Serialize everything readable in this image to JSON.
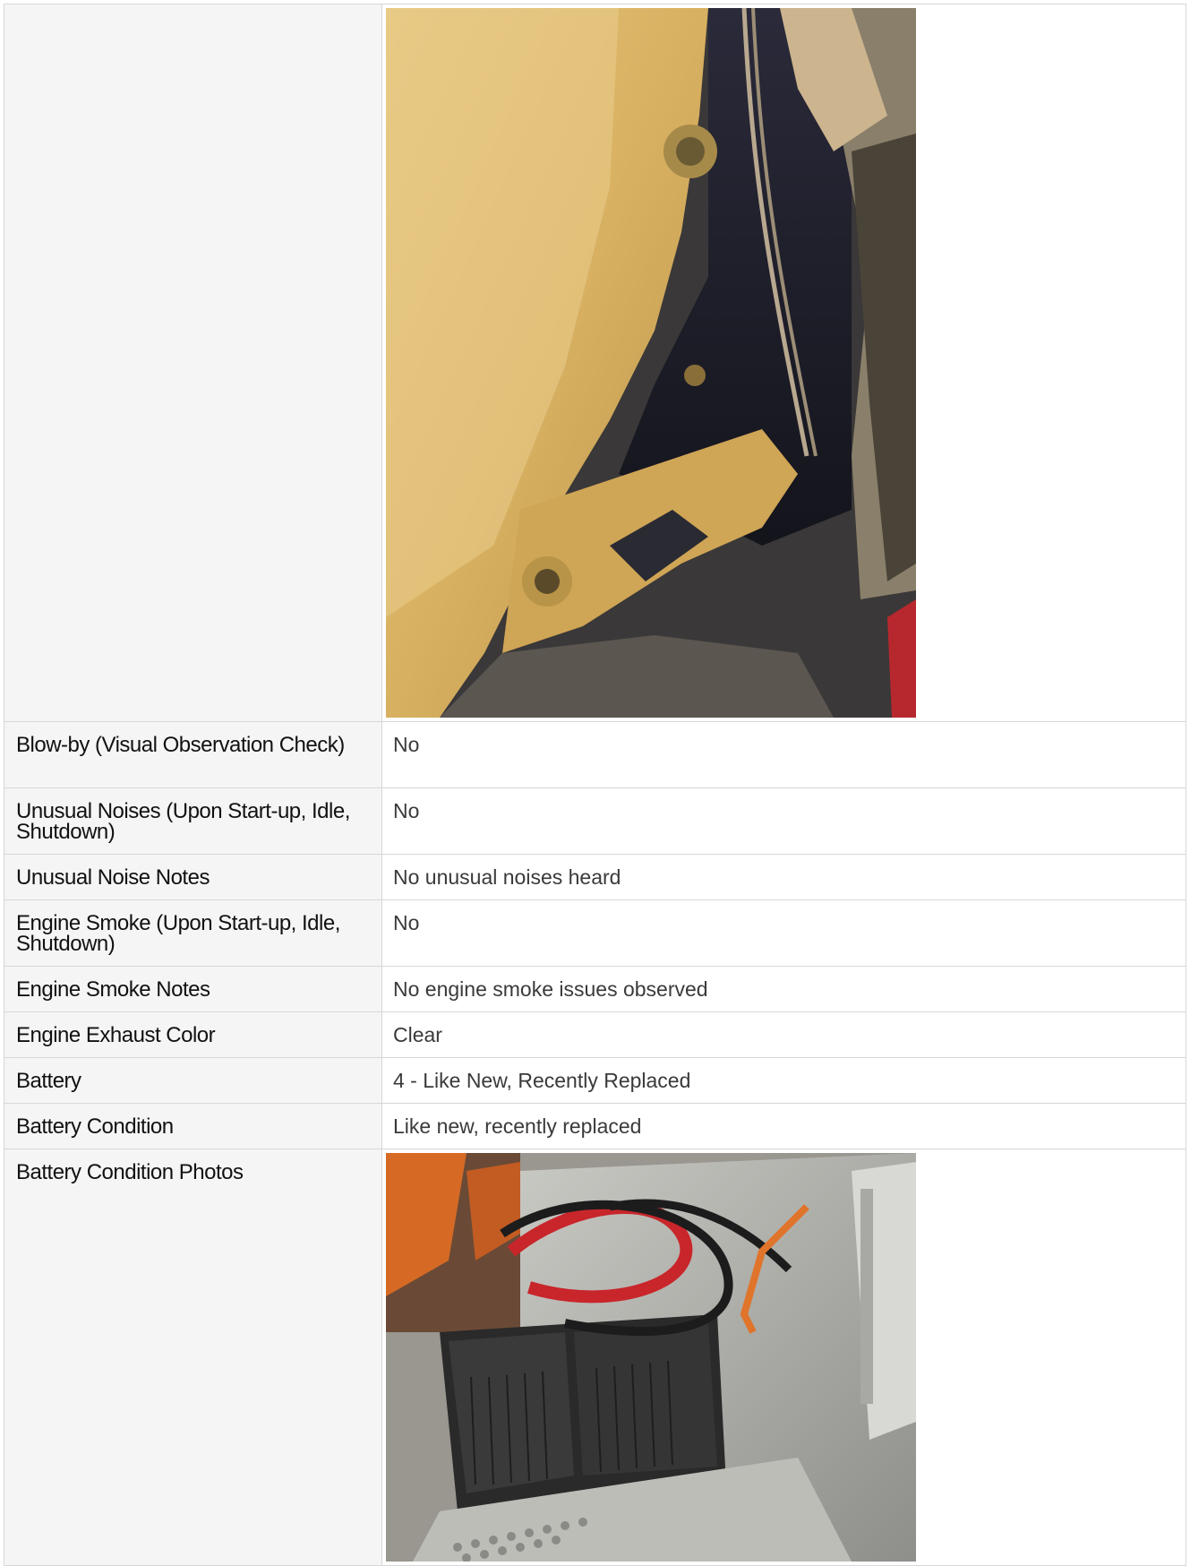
{
  "rows": [
    {
      "label": "",
      "value": "",
      "type": "photo",
      "photo": "engine-photo"
    },
    {
      "label": "Blow-by (Visual Observation Check)",
      "value": "No"
    },
    {
      "label": "Unusual Noises (Upon Start-up, Idle, Shutdown)",
      "value": "No"
    },
    {
      "label": "Unusual Noise Notes",
      "value": "No unusual noises heard"
    },
    {
      "label": "Engine Smoke (Upon Start-up, Idle, Shutdown)",
      "value": "No"
    },
    {
      "label": "Engine Smoke Notes",
      "value": "No engine smoke issues observed"
    },
    {
      "label": "Engine Exhaust Color",
      "value": "Clear"
    },
    {
      "label": "Battery",
      "value": "4 - Like New, Recently Replaced"
    },
    {
      "label": "Battery Condition",
      "value": "Like new, recently replaced"
    },
    {
      "label": "Battery Condition Photos",
      "value": "",
      "type": "photo",
      "photo": "battery-photo"
    }
  ],
  "colors": {
    "label_bg": "#f5f5f5",
    "border": "#d7d7d7",
    "engine_yellow": "#d9b25a",
    "battery_cable_red": "#c8262b",
    "battery_cable_orange": "#e0742a"
  }
}
